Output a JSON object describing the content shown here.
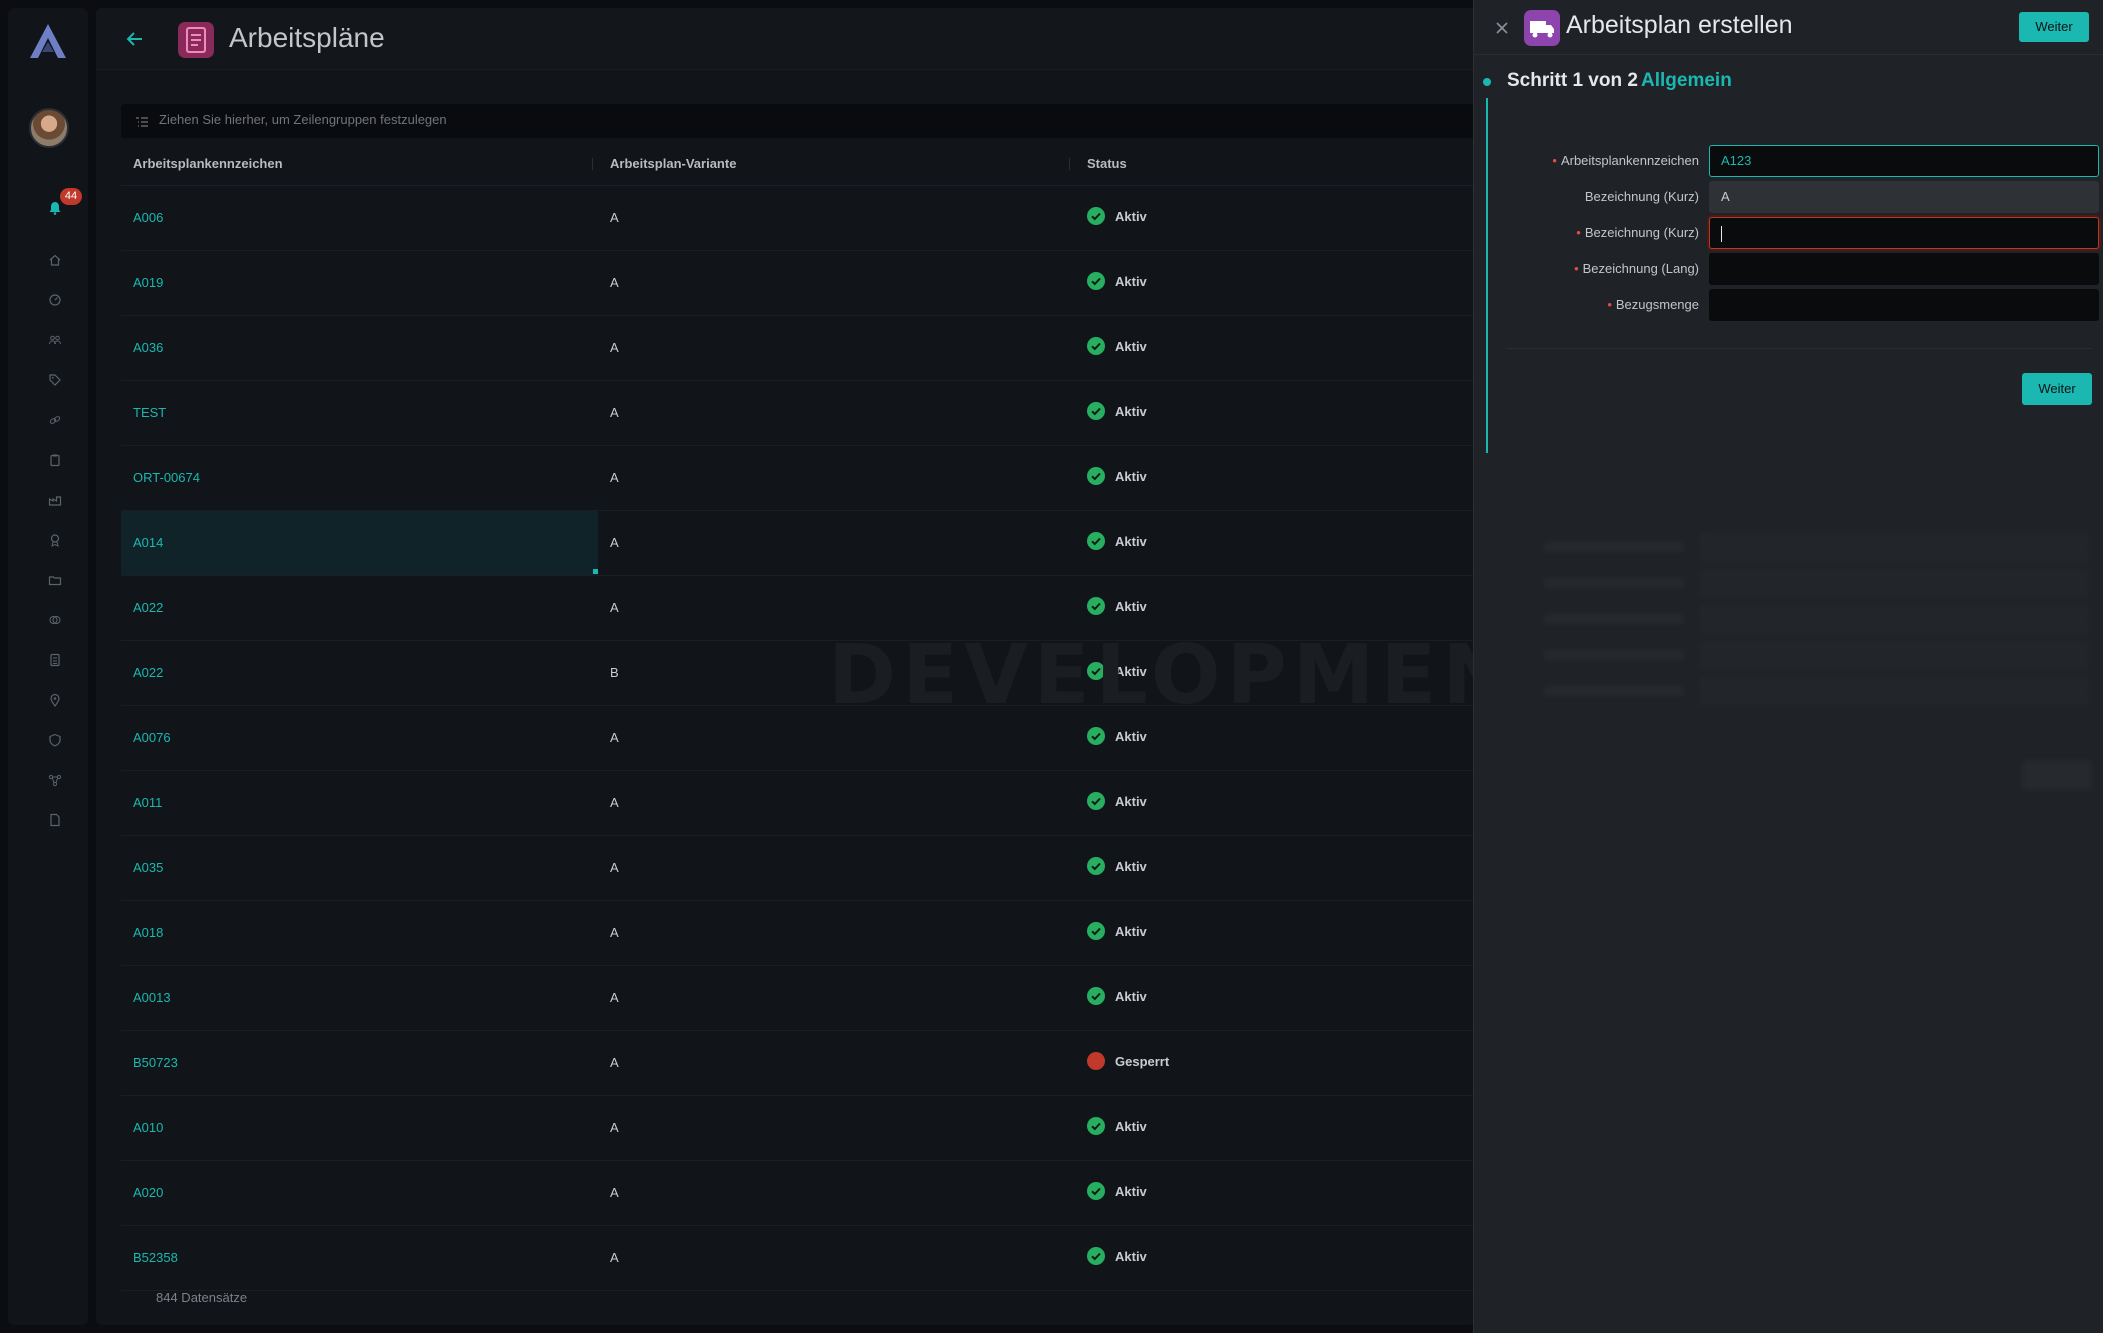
{
  "app": {
    "title": "Arbeitspläne",
    "notification_count": "44"
  },
  "table": {
    "group_hint": "Ziehen Sie hierher, um Zeilengruppen festzulegen",
    "columns": [
      "Arbeitsplankennzeichen",
      "Arbeitsplan-Variante",
      "Status"
    ],
    "rows": [
      {
        "code": "A006",
        "variant": "A",
        "status": "Aktiv",
        "state": "ok"
      },
      {
        "code": "A019",
        "variant": "A",
        "status": "Aktiv",
        "state": "ok"
      },
      {
        "code": "A036",
        "variant": "A",
        "status": "Aktiv",
        "state": "ok"
      },
      {
        "code": "TEST",
        "variant": "A",
        "status": "Aktiv",
        "state": "ok"
      },
      {
        "code": "ORT-00674",
        "variant": "A",
        "status": "Aktiv",
        "state": "ok"
      },
      {
        "code": "A014",
        "variant": "A",
        "status": "Aktiv",
        "state": "ok",
        "selected": true
      },
      {
        "code": "A022",
        "variant": "A",
        "status": "Aktiv",
        "state": "ok"
      },
      {
        "code": "A022",
        "variant": "B",
        "status": "Aktiv",
        "state": "ok"
      },
      {
        "code": "A0076",
        "variant": "A",
        "status": "Aktiv",
        "state": "ok"
      },
      {
        "code": "A011",
        "variant": "A",
        "status": "Aktiv",
        "state": "ok"
      },
      {
        "code": "A035",
        "variant": "A",
        "status": "Aktiv",
        "state": "ok"
      },
      {
        "code": "A018",
        "variant": "A",
        "status": "Aktiv",
        "state": "ok"
      },
      {
        "code": "A0013",
        "variant": "A",
        "status": "Aktiv",
        "state": "ok"
      },
      {
        "code": "B50723",
        "variant": "A",
        "status": "Gesperrt",
        "state": "locked"
      },
      {
        "code": "A010",
        "variant": "A",
        "status": "Aktiv",
        "state": "ok"
      },
      {
        "code": "A020",
        "variant": "A",
        "status": "Aktiv",
        "state": "ok"
      },
      {
        "code": "B52358",
        "variant": "A",
        "status": "Aktiv",
        "state": "ok"
      }
    ],
    "record_count": "844 Datensätze"
  },
  "watermark": "DEVELOPMENT",
  "drawer": {
    "title": "Arbeitsplan erstellen",
    "header_button": "Weiter",
    "step_label": "Schritt 1 von 2",
    "step_name": "Allgemein",
    "fields": [
      {
        "label": "Arbeitsplankennzeichen",
        "value": "A123",
        "required": true
      },
      {
        "label": "Bezeichnung (Kurz)",
        "value": "A",
        "required": false
      },
      {
        "label": "Bezeichnung (Kurz)",
        "value": "",
        "required": true
      },
      {
        "label": "Bezeichnung (Lang)",
        "value": "",
        "required": true
      },
      {
        "label": "Bezugsmenge",
        "value": "",
        "required": true
      }
    ],
    "next_button": "Weiter"
  },
  "colors": {
    "accent": "#1ab8b0",
    "status_ok": "#27ae60",
    "status_locked": "#c0392b",
    "required": "#e74c3c"
  }
}
